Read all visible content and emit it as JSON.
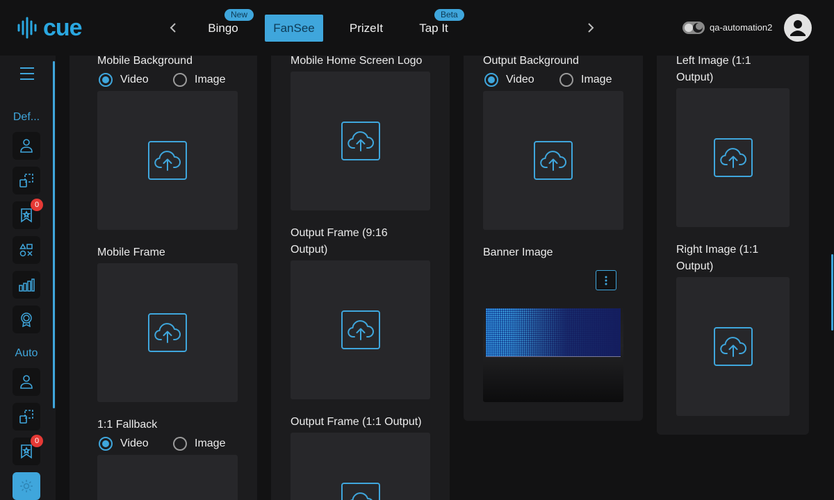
{
  "brand": {
    "logo_text": "cue",
    "accent": "#3fa6dc"
  },
  "header": {
    "tabs": [
      {
        "label": "Bingo",
        "badge": "New",
        "active": false
      },
      {
        "label": "FanSee",
        "badge": "",
        "active": true
      },
      {
        "label": "PrizeIt",
        "badge": "",
        "active": false
      },
      {
        "label": "Tap It",
        "badge": "Beta",
        "active": false
      }
    ],
    "prev_icon": "chevron-left-icon",
    "next_icon": "chevron-right-icon",
    "theme_toggle_icon": "moon-icon",
    "user_name": "qa-automation2",
    "avatar_icon": "user-icon"
  },
  "sidebar": {
    "menu_icon": "hamburger-icon",
    "sections": [
      {
        "label": "Def...",
        "items": [
          {
            "icon": "user-icon",
            "badge": ""
          },
          {
            "icon": "frame-icon",
            "badge": ""
          },
          {
            "icon": "bookmark-star-icon",
            "badge": "0"
          },
          {
            "icon": "shapes-icon",
            "badge": ""
          },
          {
            "icon": "bar-chart-icon",
            "badge": ""
          },
          {
            "icon": "award-icon",
            "badge": ""
          }
        ]
      },
      {
        "label": "Auto",
        "items": [
          {
            "icon": "user-icon",
            "badge": ""
          },
          {
            "icon": "frame-icon",
            "badge": ""
          },
          {
            "icon": "bookmark-star-icon",
            "badge": "0"
          },
          {
            "icon": "settings-icon",
            "badge": "",
            "active": true
          }
        ]
      }
    ]
  },
  "content": {
    "col1": {
      "mobile_background": {
        "label": "Mobile Background",
        "options": [
          "Video",
          "Image"
        ],
        "selected": "Video"
      },
      "mobile_frame": {
        "label": "Mobile Frame"
      },
      "fallback": {
        "label": "1:1 Fallback",
        "options": [
          "Video",
          "Image"
        ],
        "selected": "Video"
      }
    },
    "col2": {
      "home_logo": {
        "label": "Mobile Home Screen Logo"
      },
      "output_frame_916": {
        "label": "Output Frame (9:16 Output)"
      },
      "output_frame_11": {
        "label": "Output Frame (1:1 Output)"
      }
    },
    "col3": {
      "output_background": {
        "label": "Output Background",
        "options": [
          "Video",
          "Image"
        ],
        "selected": "Video"
      },
      "banner_image": {
        "label": "Banner Image",
        "menu_icon": "kebab-icon"
      }
    },
    "col4": {
      "left_image": {
        "label": "Left Image (1:1 Output)"
      },
      "right_image": {
        "label": "Right Image (1:1 Output)"
      }
    },
    "upload_icon": "cloud-upload-icon"
  }
}
